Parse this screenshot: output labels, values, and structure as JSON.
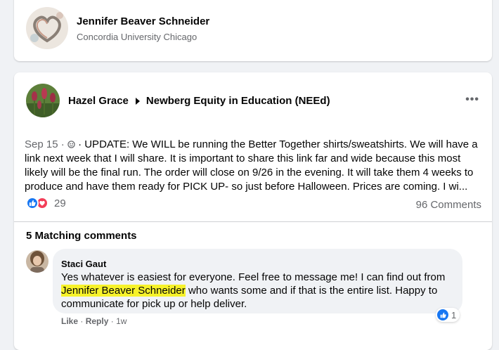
{
  "profile_card": {
    "name": "Jennifer Beaver Schneider",
    "subtitle": "Concordia University Chicago"
  },
  "post": {
    "author": "Hazel Grace",
    "group": "Newberg Equity in Education (NEEd)",
    "more_icon": "more-horizontal-icon",
    "date": "Sep 15",
    "dot": "·",
    "audience_icon": "globe-icon",
    "text": "· UPDATE: We WILL be running the Better Together shirts/sweatshirts. We will have a link next week that I will share. It is important to share this link far and wide because this most likely will be the final run. The order will close on 9/26 in the evening. It will take them 4 weeks to produce and have them ready for PICK UP- so just before Halloween. Prices are coming. I wi...",
    "reaction_count": "29",
    "comments_count": "96 Comments"
  },
  "matching": {
    "label": "5 Matching comments"
  },
  "comment": {
    "author": "Staci Gaut",
    "text_before": "Yes whatever is easiest for everyone. Feel free to message me! I can find out from",
    "highlight": "Jennifer Beaver Schneider",
    "text_after": " who wants some and if that is the entire list. Happy to communicate for pick up or help deliver.",
    "like_count": "1",
    "like_label": "Like",
    "sep": "·",
    "reply_label": "Reply",
    "time": "1w"
  },
  "colors": {
    "like_blue": "#1877f2",
    "love_red": "#f33e58",
    "highlight": "#f7f22a"
  }
}
